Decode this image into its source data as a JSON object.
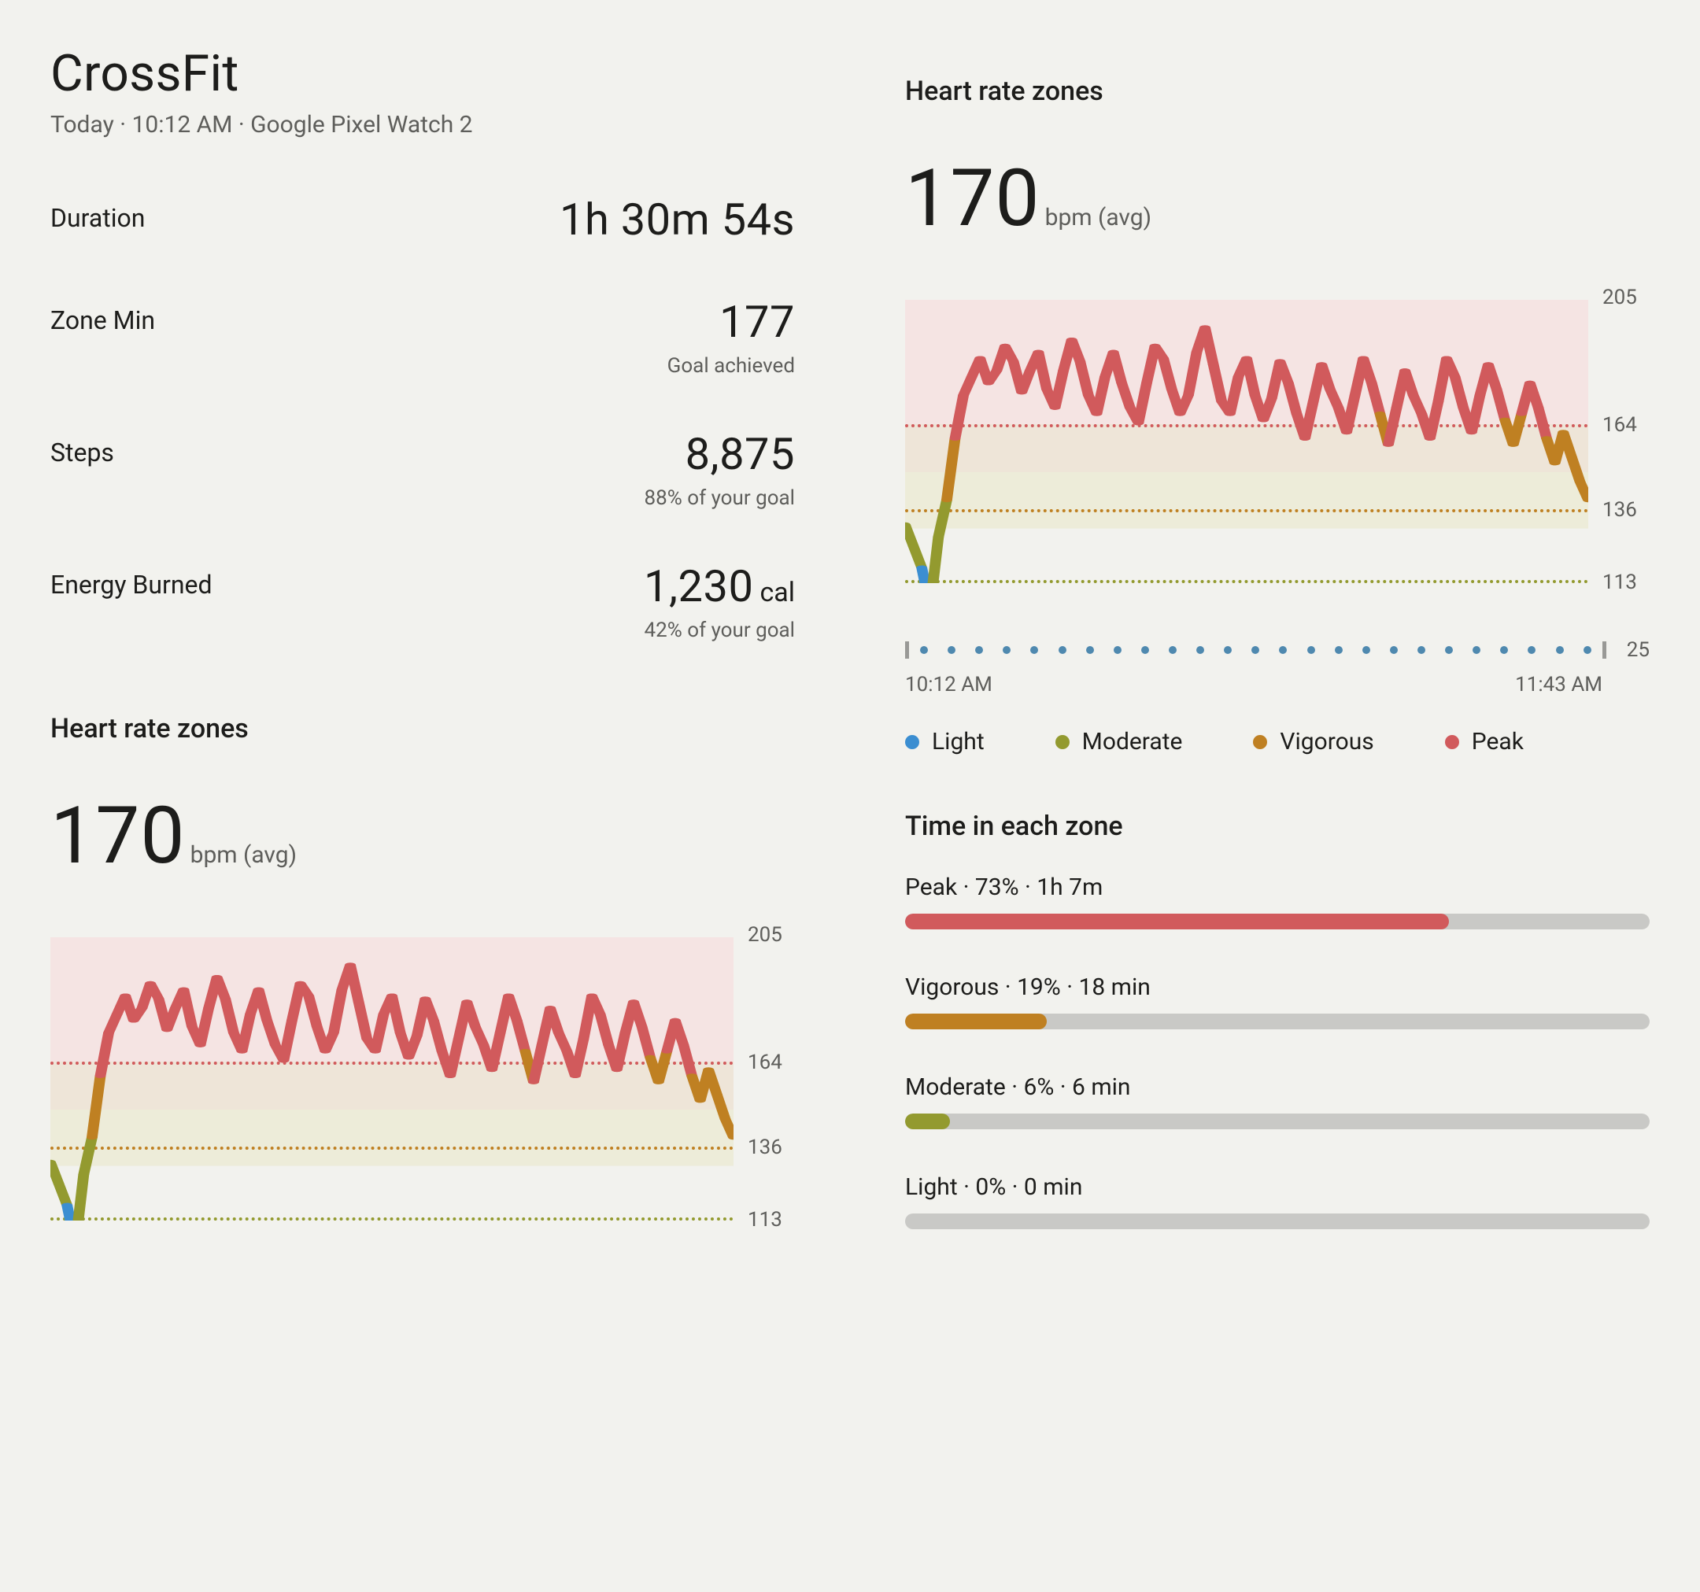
{
  "header": {
    "title": "CrossFit",
    "subline": "Today · 10:12 AM · Google Pixel Watch 2"
  },
  "stats": {
    "duration_label": "Duration",
    "duration_value": "1h 30m 54s",
    "zonemin_label": "Zone Min",
    "zonemin_value": "177",
    "zonemin_note": "Goal achieved",
    "steps_label": "Steps",
    "steps_value": "8,875",
    "steps_note": "88% of your goal",
    "energy_label": "Energy Burned",
    "energy_value": "1,230",
    "energy_unit": "cal",
    "energy_note": "42% of your goal"
  },
  "hr": {
    "section_title": "Heart rate zones",
    "value": "170",
    "unit": "bpm (avg)"
  },
  "chart_axis": {
    "y_top": "205",
    "y_164": "164",
    "y_136": "136",
    "y_113": "113"
  },
  "timeline": {
    "start": "10:12 AM",
    "end": "11:43 AM",
    "count": "25"
  },
  "legend": {
    "light": "Light",
    "moderate": "Moderate",
    "vigorous": "Vigorous",
    "peak": "Peak"
  },
  "zones_section": {
    "title": "Time in each zone"
  },
  "zones": {
    "peak": {
      "label": "Peak · 73% · 1h 7m",
      "pct": 73,
      "color": "#d15a5c"
    },
    "vigorous": {
      "label": "Vigorous · 19% · 18 min",
      "pct": 19,
      "color": "#bf8022"
    },
    "moderate": {
      "label": "Moderate · 6% · 6 min",
      "pct": 6,
      "color": "#939a2f"
    },
    "light": {
      "label": "Light · 0% · 0 min",
      "pct": 0,
      "color": "#3b8ed1"
    }
  },
  "chart_data": {
    "type": "line",
    "title": "Heart rate zones",
    "xlabel": "time",
    "ylabel": "bpm",
    "ylim": [
      113,
      205
    ],
    "zone_bounds": {
      "light_min": 113,
      "moderate_min": 113,
      "vigorous_min": 136,
      "peak_min": 164,
      "max": 205
    },
    "x_range": [
      "10:12 AM",
      "11:43 AM"
    ],
    "values": [
      132,
      125,
      118,
      105,
      128,
      140,
      160,
      174,
      180,
      186,
      178,
      182,
      190,
      185,
      175,
      182,
      188,
      176,
      170,
      182,
      192,
      185,
      174,
      168,
      180,
      188,
      178,
      170,
      165,
      178,
      190,
      186,
      176,
      168,
      174,
      188,
      196,
      184,
      172,
      168,
      180,
      186,
      174,
      166,
      173,
      185,
      178,
      168,
      160,
      172,
      184,
      176,
      170,
      162,
      174,
      186,
      178,
      168,
      158,
      170,
      182,
      174,
      168,
      160,
      172,
      186,
      180,
      170,
      162,
      174,
      184,
      176,
      166,
      158,
      168,
      178,
      170,
      160,
      152,
      162,
      154,
      146,
      140
    ]
  }
}
